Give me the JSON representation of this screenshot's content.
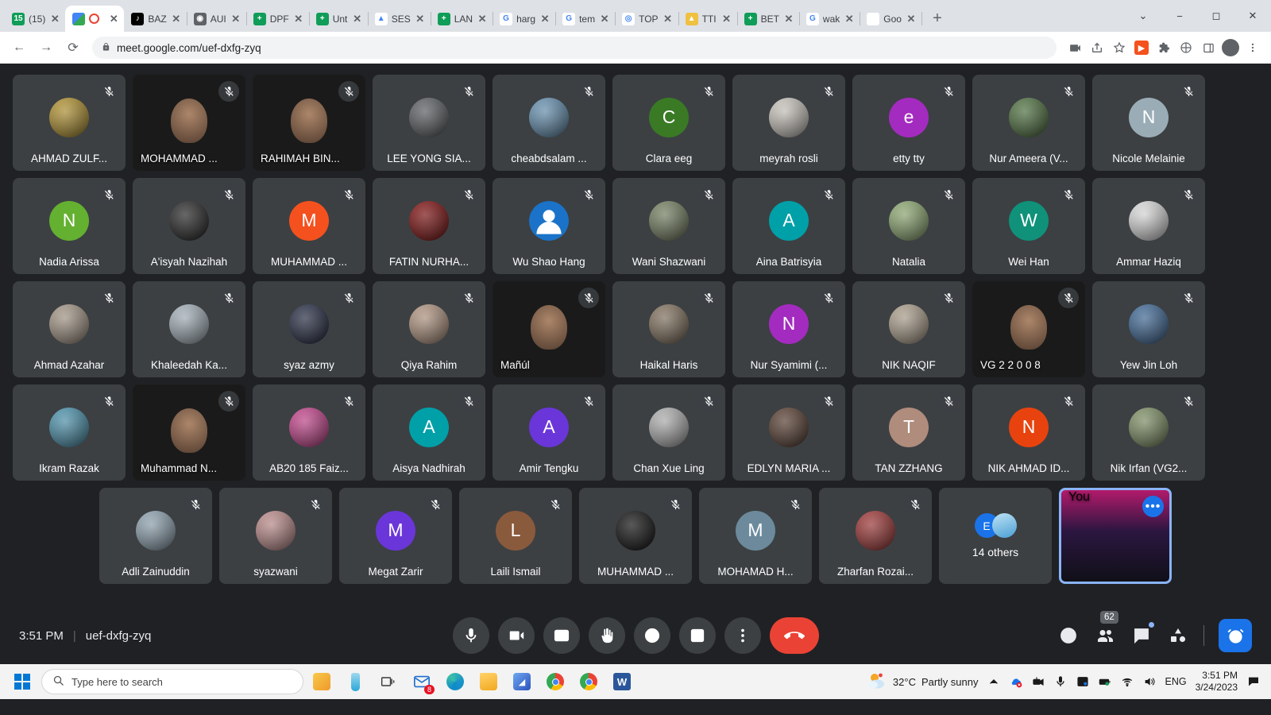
{
  "browser": {
    "tabs": [
      {
        "label": "(15)",
        "favicon_text": "15",
        "favicon_color": "#0f9d58",
        "active": false
      },
      {
        "label": "",
        "favicon_text": "",
        "favicon_color": "#ffffff",
        "active": true,
        "recording": true
      },
      {
        "label": "BAZ",
        "favicon_text": "♪",
        "favicon_color": "#010101",
        "active": false
      },
      {
        "label": "AUI",
        "favicon_text": "◉",
        "favicon_color": "#5f6368",
        "active": false
      },
      {
        "label": "DPF",
        "favicon_text": "+",
        "favicon_color": "#0f9d58",
        "active": false
      },
      {
        "label": "Unt",
        "favicon_text": "+",
        "favicon_color": "#0f9d58",
        "active": false
      },
      {
        "label": "SES",
        "favicon_text": "▲",
        "favicon_color": "#ffffff",
        "active": false
      },
      {
        "label": "LAN",
        "favicon_text": "+",
        "favicon_color": "#0f9d58",
        "active": false
      },
      {
        "label": "harg",
        "favicon_text": "G",
        "favicon_color": "#ffffff",
        "active": false
      },
      {
        "label": "tem",
        "favicon_text": "G",
        "favicon_color": "#ffffff",
        "active": false
      },
      {
        "label": "TOP",
        "favicon_text": "◎",
        "favicon_color": "#ffffff",
        "active": false
      },
      {
        "label": "TTI",
        "favicon_text": "▲",
        "favicon_color": "#f0c040",
        "active": false
      },
      {
        "label": "BET",
        "favicon_text": "+",
        "favicon_color": "#0f9d58",
        "active": false
      },
      {
        "label": "wak",
        "favicon_text": "G",
        "favicon_color": "#ffffff",
        "active": false
      },
      {
        "label": "Goo",
        "favicon_text": "",
        "favicon_color": "#ffffff",
        "active": false
      }
    ],
    "new_tab_label": "+",
    "tab_close_label": "✕",
    "tab_search_label": "⌄",
    "window_minimize": "−",
    "window_maximize": "◻",
    "window_close": "✕",
    "url": "meet.google.com/uef-dxfg-zyq",
    "back_label": "←",
    "forward_label": "→",
    "reload_label": "⟳",
    "lock_icon": "🔒",
    "toolbar_icons": [
      "video-icon",
      "share-icon",
      "bookmark-star-icon",
      "extension-orange-icon",
      "puzzle-icon",
      "shield-icon",
      "sidepanel-icon",
      "profile-avatar",
      "menu-icon"
    ],
    "profile_initial": ""
  },
  "meet": {
    "rows": [
      [
        {
          "name": "AHMAD ZULF...",
          "type": "avatar-photo",
          "photo": "photo-cap",
          "color": "#c9a227",
          "muted": true
        },
        {
          "name": "MOHAMMAD ...",
          "type": "video",
          "video": "vid-moh",
          "muted": true
        },
        {
          "name": "RAHIMAH BIN...",
          "type": "video",
          "video": "vid-rah",
          "muted": true
        },
        {
          "name": "LEE YONG SIA...",
          "type": "avatar-photo",
          "photo": "photo-suit",
          "color": "#5f6368",
          "muted": true
        },
        {
          "name": "cheabdsalam ...",
          "type": "avatar-photo",
          "photo": "photo-beach",
          "color": "#6aa0c8",
          "muted": true
        },
        {
          "name": "Clara eeg",
          "type": "initial",
          "initial": "C",
          "color": "#3a7a25",
          "muted": true
        },
        {
          "name": "meyrah rosli",
          "type": "avatar-photo",
          "photo": "photo-bird",
          "color": "#e8e2d8",
          "muted": true
        },
        {
          "name": "etty tty",
          "type": "initial",
          "initial": "e",
          "color": "#a42bbf",
          "muted": true
        },
        {
          "name": "Nur Ameera (V...",
          "type": "avatar-photo",
          "photo": "photo-grad",
          "color": "#4f7a3c",
          "muted": true
        },
        {
          "name": "Nicole Melainie",
          "type": "initial",
          "initial": "N",
          "color": "#9aadb7",
          "muted": true
        }
      ],
      [
        {
          "name": "Nadia Arissa",
          "type": "initial",
          "initial": "N",
          "color": "#64b030",
          "muted": true
        },
        {
          "name": "A'isyah Nazihah",
          "type": "avatar-photo",
          "photo": "photo-dark",
          "color": "#1c1c1c",
          "muted": true
        },
        {
          "name": "MUHAMMAD ...",
          "type": "initial",
          "initial": "M",
          "color": "#f4511e",
          "muted": true
        },
        {
          "name": "FATIN NURHA...",
          "type": "avatar-photo",
          "photo": "photo-red",
          "color": "#8a0000",
          "muted": true
        },
        {
          "name": "Wu Shao Hang",
          "type": "avatar-person",
          "color": "#1a73c8",
          "muted": true
        },
        {
          "name": "Wani Shazwani",
          "type": "avatar-photo",
          "photo": "photo-garden",
          "color": "#7e8c66",
          "muted": true
        },
        {
          "name": "Aina Batrisyia",
          "type": "initial",
          "initial": "A",
          "color": "#00a0a8",
          "muted": true
        },
        {
          "name": "Natalia",
          "type": "avatar-photo",
          "photo": "photo-drink",
          "color": "#9dbf7a",
          "muted": true
        },
        {
          "name": "Wei Han",
          "type": "initial",
          "initial": "W",
          "color": "#0f9279",
          "muted": true
        },
        {
          "name": "Ammar Haziq",
          "type": "avatar-photo",
          "photo": "photo-mono",
          "color": "#ffffff",
          "muted": true
        }
      ],
      [
        {
          "name": "Ahmad Azahar",
          "type": "avatar-photo",
          "photo": "photo-beachman",
          "color": "#b9a894",
          "muted": true
        },
        {
          "name": "Khaleedah Ka...",
          "type": "avatar-photo",
          "photo": "photo-mall",
          "color": "#b9c9d4",
          "muted": true
        },
        {
          "name": "syaz azmy",
          "type": "avatar-photo",
          "photo": "photo-night",
          "color": "#1b2340",
          "muted": true
        },
        {
          "name": "Qiya Rahim",
          "type": "avatar-photo",
          "photo": "photo-girl",
          "color": "#c9a58c",
          "muted": true
        },
        {
          "name": "Mañúl",
          "type": "video",
          "video": "vid-man",
          "muted": true
        },
        {
          "name": "Haikal Haris",
          "type": "avatar-photo",
          "photo": "photo-house",
          "color": "#8e7a62",
          "muted": true
        },
        {
          "name": "Nur Syamimi (...",
          "type": "initial",
          "initial": "N",
          "color": "#a42bbf",
          "muted": true
        },
        {
          "name": "NIK NAQIF",
          "type": "avatar-photo",
          "photo": "photo-flowers",
          "color": "#c4b49c",
          "muted": true
        },
        {
          "name": "VG 2 2 0 0 8",
          "type": "video",
          "video": "vid-vg",
          "muted": true
        },
        {
          "name": "Yew Jin Loh",
          "type": "avatar-photo",
          "photo": "photo-blue",
          "color": "#3b6fa8",
          "muted": true
        }
      ],
      [
        {
          "name": "Ikram Razak",
          "type": "avatar-photo",
          "photo": "photo-water",
          "color": "#4aa3c4",
          "muted": true
        },
        {
          "name": "Muhammad N...",
          "type": "video",
          "video": "vid-mun",
          "muted": true
        },
        {
          "name": "AB20 185 Faiz...",
          "type": "avatar-photo",
          "photo": "photo-pink",
          "color": "#e0409a",
          "muted": true
        },
        {
          "name": "Aisya Nadhirah",
          "type": "initial",
          "initial": "A",
          "color": "#00a0a8",
          "muted": true
        },
        {
          "name": "Amir Tengku",
          "type": "initial",
          "initial": "A",
          "color": "#6a36d9",
          "muted": true
        },
        {
          "name": "Chan Xue Ling",
          "type": "avatar-photo",
          "photo": "photo-lady",
          "color": "#c8c8c8",
          "muted": true
        },
        {
          "name": "EDLYN MARIA ...",
          "type": "avatar-photo",
          "photo": "photo-edlyn",
          "color": "#5a3a2a",
          "muted": true
        },
        {
          "name": "TAN ZZHANG",
          "type": "initial",
          "initial": "T",
          "color": "#b08c7d",
          "muted": true
        },
        {
          "name": "NIK AHMAD ID...",
          "type": "initial",
          "initial": "N",
          "color": "#e8430f",
          "muted": true
        },
        {
          "name": "Nik Irfan (VG2...",
          "type": "avatar-photo",
          "photo": "photo-park",
          "color": "#8aa06a",
          "muted": true
        }
      ],
      [
        {
          "name": "Adli Zainuddin",
          "type": "avatar-photo",
          "photo": "photo-window",
          "color": "#9fb8c9",
          "muted": true
        },
        {
          "name": "syazwani",
          "type": "avatar-photo",
          "photo": "photo-sunset",
          "color": "#d89a9a",
          "muted": true
        },
        {
          "name": "Megat Zarir",
          "type": "initial",
          "initial": "M",
          "color": "#6a36d9",
          "muted": true
        },
        {
          "name": "Laili Ismail",
          "type": "initial",
          "initial": "L",
          "color": "#8a5a3c",
          "muted": true
        },
        {
          "name": "MUHAMMAD ...",
          "type": "avatar-photo",
          "photo": "photo-black",
          "color": "#000000",
          "muted": true
        },
        {
          "name": "MOHAMAD H...",
          "type": "initial",
          "initial": "M",
          "color": "#6c8a9c",
          "muted": true
        },
        {
          "name": "Zharfan Rozai...",
          "type": "avatar-photo",
          "photo": "photo-door",
          "color": "#b43030",
          "muted": true
        }
      ]
    ],
    "others_tile": {
      "label": "14 others",
      "avatar_initial": "E",
      "avatar_color": "#1a73e8",
      "second_color": "#4a9fd4"
    },
    "self_tile": {
      "label": "You",
      "more_label": "•••"
    },
    "bottom_bar": {
      "time": "3:51 PM",
      "separator": "|",
      "meeting_code": "uef-dxfg-zyq",
      "controls": [
        {
          "name": "microphone-button",
          "icon": "mic-icon"
        },
        {
          "name": "camera-button",
          "icon": "camera-icon"
        },
        {
          "name": "captions-button",
          "icon": "cc-icon"
        },
        {
          "name": "raise-hand-button",
          "icon": "hand-icon"
        },
        {
          "name": "reactions-button",
          "icon": "emoji-icon"
        },
        {
          "name": "present-now-button",
          "icon": "present-icon"
        },
        {
          "name": "more-options-button",
          "icon": "kebab-icon"
        },
        {
          "name": "leave-call-button",
          "icon": "hangup-icon"
        }
      ],
      "right_controls": [
        {
          "name": "meeting-details-button",
          "icon": "info-icon",
          "badge": ""
        },
        {
          "name": "show-everyone-button",
          "icon": "people-icon",
          "badge": "62"
        },
        {
          "name": "chat-button",
          "icon": "chat-icon",
          "badge": "",
          "dot": true
        },
        {
          "name": "activities-button",
          "icon": "activities-icon",
          "badge": ""
        }
      ],
      "timer_button": {
        "name": "timer-button",
        "icon": "alarm-icon"
      }
    }
  },
  "taskbar": {
    "search_placeholder": "Type here to search",
    "search_icon": "magnifier-icon",
    "start_icon": "windows-logo",
    "apps": [
      {
        "name": "store-icon",
        "color": "#f6c24d",
        "badge": ""
      },
      {
        "name": "bottle-icon",
        "color": "#2aa8d8",
        "badge": ""
      },
      {
        "name": "task-view-icon",
        "color": "#444444",
        "badge": ""
      },
      {
        "name": "mail-icon",
        "color": "#1f6fd0",
        "badge": "8"
      },
      {
        "name": "edge-icon",
        "color": "#1b94c8",
        "badge": ""
      },
      {
        "name": "explorer-icon",
        "color": "#f2b134",
        "badge": ""
      },
      {
        "name": "mediaplayer-icon",
        "color": "#3f66c7",
        "badge": ""
      },
      {
        "name": "chrome-icon",
        "color": "#f4b400",
        "badge": ""
      },
      {
        "name": "chrome-icon-2",
        "color": "#f4b400",
        "badge": ""
      },
      {
        "name": "word-icon",
        "color": "#2b579a",
        "badge": ""
      }
    ],
    "weather": {
      "temperature": "32°C",
      "condition": "Partly sunny"
    },
    "tray_icons": [
      "chevron-up-icon",
      "onedrive-icon",
      "screenrec-icon",
      "microphone-icon",
      "webcam-icon",
      "battery-icon",
      "wifi-icon",
      "volume-icon"
    ],
    "language": "ENG",
    "clock_time": "3:51 PM",
    "clock_date": "3/24/2023",
    "notification_icon": "notification-icon"
  }
}
